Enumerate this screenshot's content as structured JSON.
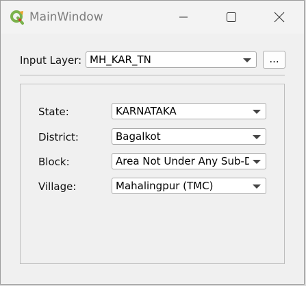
{
  "window": {
    "title": "MainWindow"
  },
  "titlebar": {
    "minimize_icon": "minimize-icon",
    "maximize_icon": "maximize-icon",
    "close_icon": "close-icon",
    "app_icon": "qgis-logo"
  },
  "input_layer": {
    "label": "Input Layer:",
    "value": "MH_KAR_TN",
    "browse_label": "..."
  },
  "filters": {
    "state": {
      "label": "State:",
      "value": "KARNATAKA"
    },
    "district": {
      "label": "District:",
      "value": "Bagalkot"
    },
    "block": {
      "label": "Block:",
      "value": "Area Not Under Any Sub-D"
    },
    "village": {
      "label": "Village:",
      "value": "Mahalingpur (TMC)"
    }
  }
}
